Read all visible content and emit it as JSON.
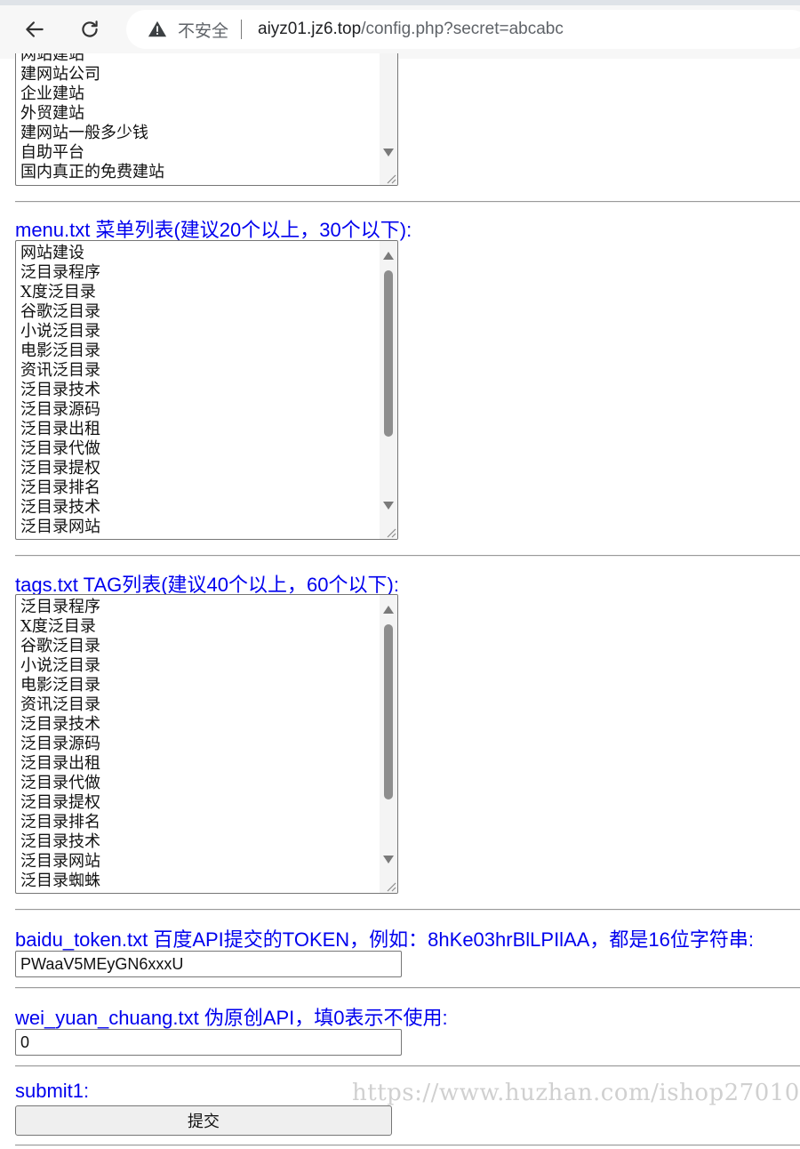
{
  "browser": {
    "security_label": "不安全",
    "url_host": "aiyz01.jz6.top",
    "url_path": "/config.php?secret=abcabc"
  },
  "keywords": {
    "visible_lines": [
      "网站建站",
      "建网站公司",
      "企业建站",
      "外贸建站",
      "建网站一般多少钱",
      "自助平台",
      "国内真正的免费建站"
    ]
  },
  "menu": {
    "label": "menu.txt 菜单列表(建议20个以上，30个以下):",
    "visible_lines": [
      "网站建设",
      "泛目录程序",
      "X度泛目录",
      "谷歌泛目录",
      "小说泛目录",
      "电影泛目录",
      "资讯泛目录",
      "泛目录技术",
      "泛目录源码",
      "泛目录出租",
      "泛目录代做",
      "泛目录提权",
      "泛目录排名",
      "泛目录技术",
      "泛目录网站"
    ]
  },
  "tags": {
    "label": "tags.txt TAG列表(建议40个以上，60个以下):",
    "visible_lines": [
      "泛目录程序",
      "X度泛目录",
      "谷歌泛目录",
      "小说泛目录",
      "电影泛目录",
      "资讯泛目录",
      "泛目录技术",
      "泛目录源码",
      "泛目录出租",
      "泛目录代做",
      "泛目录提权",
      "泛目录排名",
      "泛目录技术",
      "泛目录网站",
      "泛目录蜘蛛"
    ]
  },
  "baidu_token": {
    "label": "baidu_token.txt 百度API提交的TOKEN，例如：8hKe03hrBlLPIlAA，都是16位字符串:",
    "value": "PWaaV5MEyGN6xxxU"
  },
  "wei_yuan_chuang": {
    "label": "wei_yuan_chuang.txt 伪原创API，填0表示不使用:",
    "value": "0"
  },
  "submit": {
    "label": "submit1:",
    "button_label": "提交"
  },
  "watermark": {
    "text": "https://www.huzhan.com/ishop27010"
  }
}
